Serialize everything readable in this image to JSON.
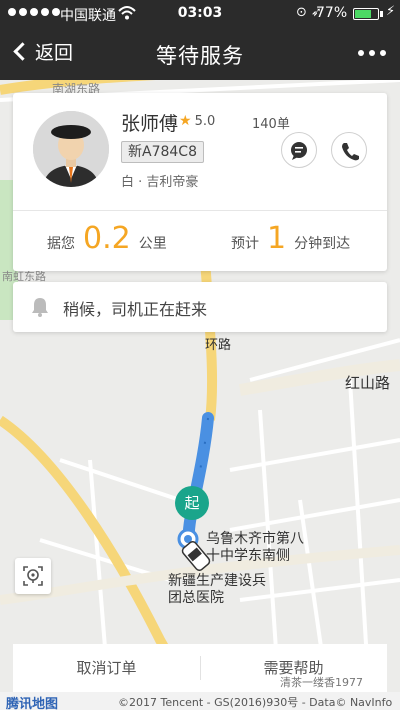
{
  "status_bar": {
    "carrier": "中国联通",
    "time": "03:03",
    "battery_percent": "77%",
    "battery_level": 0.77
  },
  "nav": {
    "back_label": "返回",
    "title": "等待服务"
  },
  "driver": {
    "name": "张师傅",
    "rating": "5.0",
    "orders": "140单",
    "plate": "新A784C8",
    "car": "白 · 吉利帝豪"
  },
  "trip": {
    "distance_label": "据您",
    "distance_value": "0.2",
    "distance_unit": "公里",
    "eta_label": "预计",
    "eta_value": "1",
    "eta_unit": "分钟到达"
  },
  "notice": {
    "text": "稍候，司机正在赶来"
  },
  "map": {
    "road_labels": {
      "top_road": "南湖东路",
      "ring_road": "环路",
      "hongshan_road": "红山路",
      "left_road": "南虹东路"
    },
    "pickup_badge": "起",
    "pickup_poi": "乌鲁木齐市第八十中学东南侧",
    "hospital_poi": "新疆生产建设兵团总医院",
    "route_color": "#4a90e2",
    "pickup_color": "#1aa58b"
  },
  "actions": {
    "cancel_label": "取消订单",
    "help_label": "需要帮助"
  },
  "footer": {
    "logo": "腾讯地图",
    "copyright": "©2017 Tencent - GS(2016)930号 - Data© NavInfo",
    "watermark": "清茶一缕香1977"
  }
}
